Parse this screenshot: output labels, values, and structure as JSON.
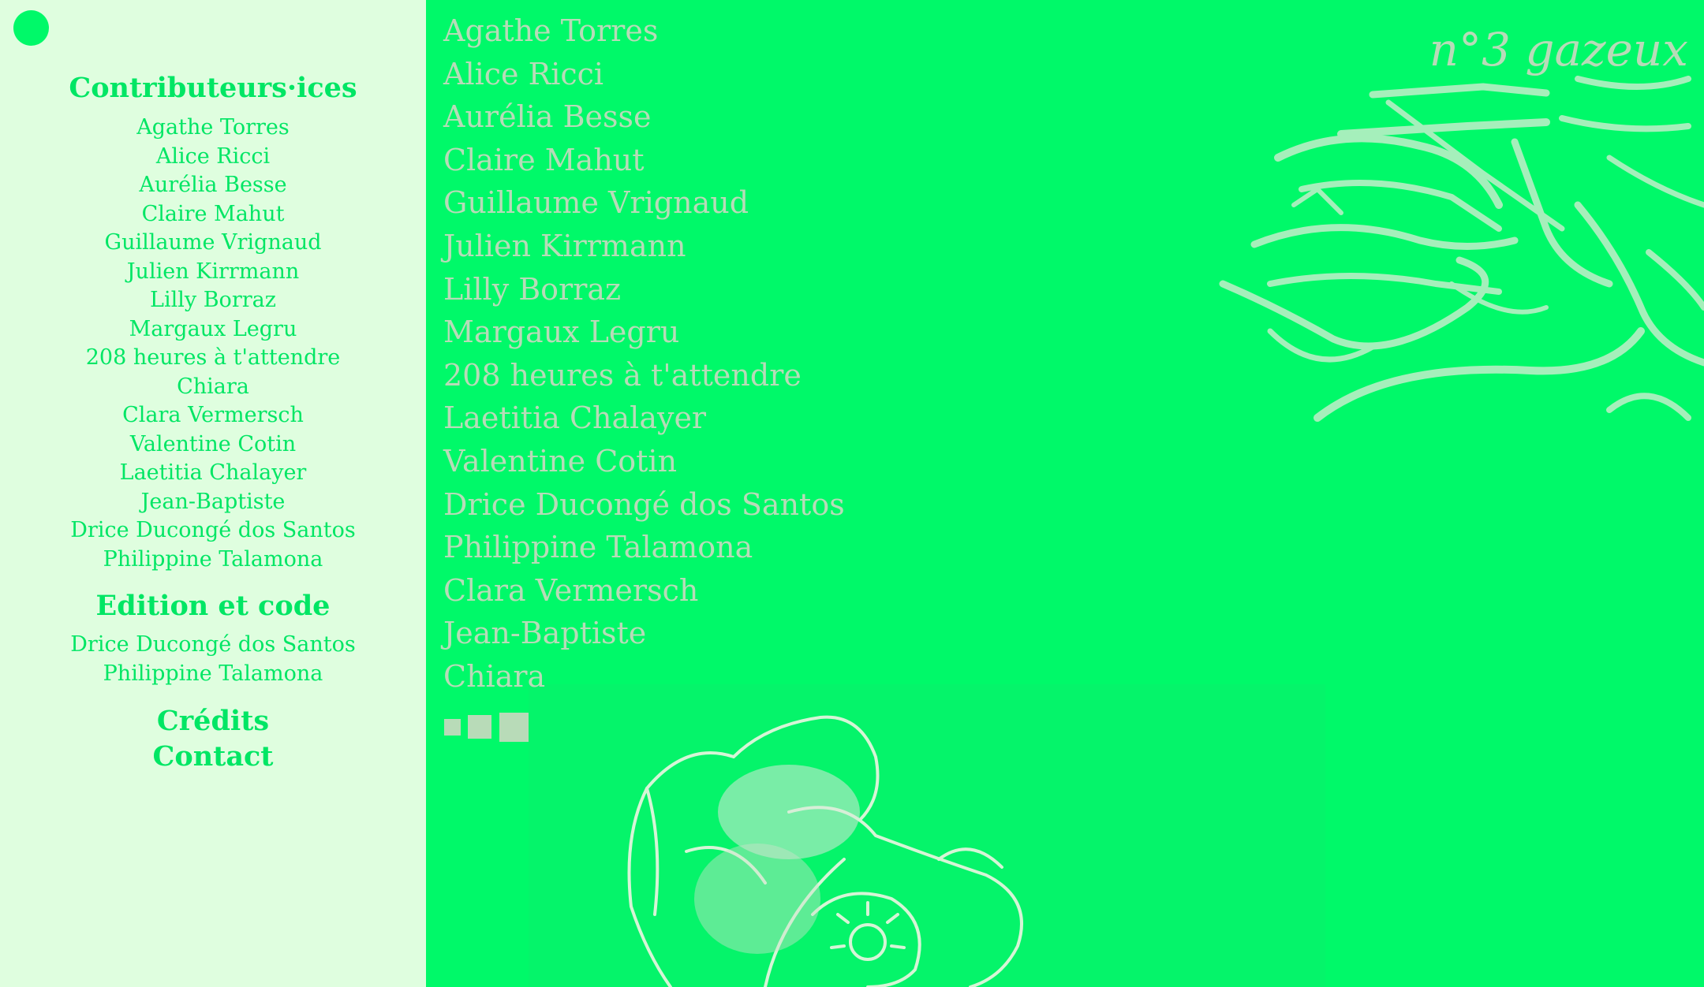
{
  "sidebar": {
    "contributors_heading": "Contributeurs·ices",
    "contributors": [
      "Agathe Torres",
      "Alice Ricci",
      "Aurélia Besse",
      "Claire Mahut",
      "Guillaume Vrignaud",
      "Julien Kirrmann",
      "Lilly Borraz",
      "Margaux Legru",
      "208 heures à t'attendre",
      "Chiara",
      "Clara Vermersch",
      "Valentine Cotin",
      "Laetitia Chalayer",
      "Jean-Baptiste",
      "Drice Ducongé dos Santos",
      "Philippine Talamona"
    ],
    "edition_heading": "Edition et code",
    "editors": [
      "Drice Ducongé dos Santos",
      "Philippine Talamona"
    ],
    "credits_label": "Crédits",
    "contact_label": "Contact"
  },
  "main": {
    "issue_title": "n°3 gazeux",
    "contributors": [
      "Agathe Torres",
      "Alice Ricci",
      "Aurélia Besse",
      "Claire Mahut",
      "Guillaume Vrignaud",
      "Julien Kirrmann",
      "Lilly Borraz",
      "Margaux Legru",
      "208 heures à t'attendre",
      "Laetitia Chalayer",
      "Valentine Cotin",
      "Drice Ducongé dos Santos",
      "Philippine Talamona",
      "Clara Vermersch",
      "Jean-Baptiste",
      "Chiara"
    ]
  },
  "colors": {
    "accent_green": "#00f969",
    "sidebar_bg": "#dffedf",
    "sidebar_text": "#00e664",
    "main_text": "#b8dbb8"
  }
}
